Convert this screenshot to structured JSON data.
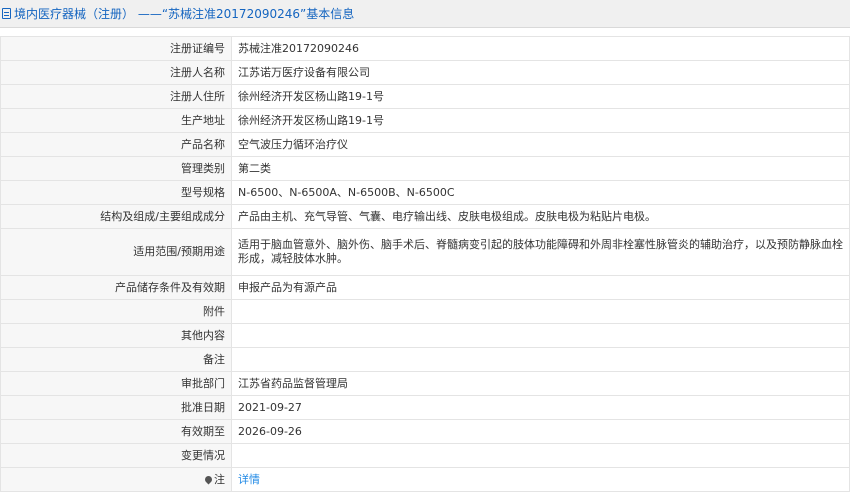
{
  "header": {
    "title": "境内医疗器械（注册） ——“苏械注准20172090246”基本信息"
  },
  "rows": [
    {
      "label": "注册证编号",
      "value": "苏械注准20172090246"
    },
    {
      "label": "注册人名称",
      "value": "江苏诺万医疗设备有限公司"
    },
    {
      "label": "注册人住所",
      "value": "徐州经济开发区杨山路19-1号"
    },
    {
      "label": "生产地址",
      "value": "徐州经济开发区杨山路19-1号"
    },
    {
      "label": "产品名称",
      "value": "空气波压力循环治疗仪"
    },
    {
      "label": "管理类别",
      "value": "第二类"
    },
    {
      "label": "型号规格",
      "value": "N-6500、N-6500A、N-6500B、N-6500C"
    },
    {
      "label": "结构及组成/主要组成成分",
      "value": "产品由主机、充气导管、气囊、电疗输出线、皮肤电极组成。皮肤电极为粘贴片电极。"
    },
    {
      "label": "适用范围/预期用途",
      "value": "适用于脑血管意外、脑外伤、脑手术后、脊髓病变引起的肢体功能障碍和外周非栓塞性脉管炎的辅助治疗，以及预防静脉血栓形成，减轻肢体水肿。"
    },
    {
      "label": "产品储存条件及有效期",
      "value": "申报产品为有源产品"
    },
    {
      "label": "附件",
      "value": ""
    },
    {
      "label": "其他内容",
      "value": ""
    },
    {
      "label": "备注",
      "value": ""
    },
    {
      "label": "审批部门",
      "value": "江苏省药品监督管理局"
    },
    {
      "label": "批准日期",
      "value": "2021-09-27"
    },
    {
      "label": "有效期至",
      "value": "2026-09-26"
    },
    {
      "label": "变更情况",
      "value": ""
    }
  ],
  "note": {
    "label": "注",
    "link_text": "详情",
    "icon": "pin-icon"
  },
  "colors": {
    "header_text": "#1565c0",
    "link": "#1e88e5",
    "label_bg": "#f7f7f7"
  }
}
